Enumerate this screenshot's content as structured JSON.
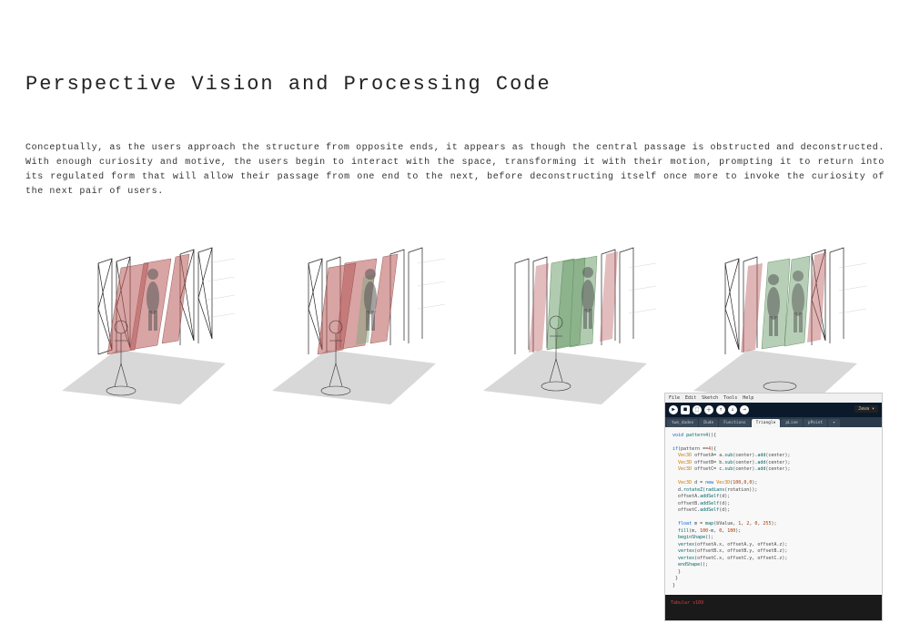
{
  "title": "Perspective Vision and Processing Code",
  "body": "Conceptually, as the users approach the structure from opposite ends, it appears as though the central passage is obstructed and deconstructed. With enough curiosity and motive, the users begin to interact with the space, transforming it with their motion, prompting it to return into its regulated form that will allow their passage from one end to the next, before deconstructing itself once more to invoke the curiosity of the next pair of users.",
  "diagrams": [
    {
      "state": "obstructed-red"
    },
    {
      "state": "approaching-red"
    },
    {
      "state": "passage-green"
    },
    {
      "state": "passing-mixed"
    }
  ],
  "ide": {
    "menu": [
      "File",
      "Edit",
      "Sketch",
      "Tools",
      "Help"
    ],
    "mode_label": "Java ▾",
    "tabs": [
      "two_dudes",
      "Dude",
      "Functions",
      "Triangle",
      "pLine",
      "pPoint"
    ],
    "active_tab_index": 3,
    "code_lines": [
      "void pattern4(){",
      "",
      "if(pattern ==4){",
      "  Vec3D offsetA= a.sub(center).add(center);",
      "  Vec3D offsetB= b.sub(center).add(center);",
      "  Vec3D offsetC= c.sub(center).add(center);",
      "",
      "  Vec3D d = new Vec3D(100,0,0);",
      "  d.rotateZ(radians(rotation));",
      "  offsetA.addSelf(d);",
      "  offsetB.addSelf(d);",
      "  offsetC.addSelf(d);",
      "",
      "  float m = map(bValue, 1, 2, 0, 255);",
      "  fill(m, 100-m, 0, 100);",
      "  beginShape();",
      "  vertex(offsetA.x, offsetA.y, offsetA.z);",
      "  vertex(offsetB.x, offsetB.y, offsetB.z);",
      "  vertex(offsetC.x, offsetC.y, offsetC.z);",
      "  endShape();",
      "  }",
      " }",
      "}"
    ],
    "console": "Tabular v109"
  }
}
